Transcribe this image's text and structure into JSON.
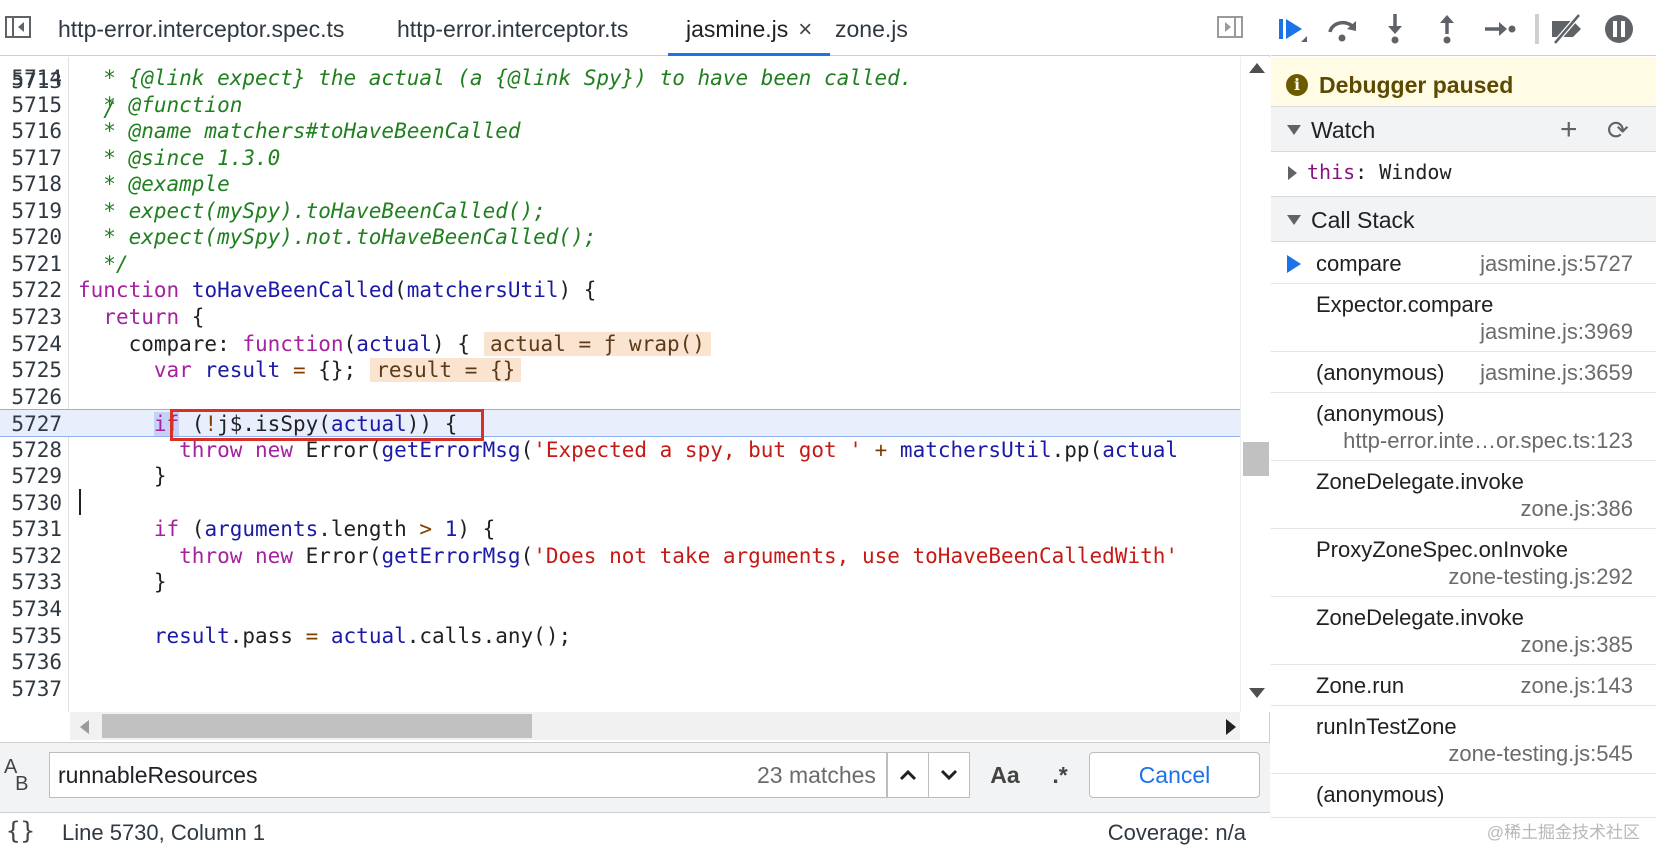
{
  "tabs": [
    {
      "label": "http-error.interceptor.spec.ts"
    },
    {
      "label": "http-error.interceptor.ts"
    },
    {
      "label": "jasmine.js",
      "close": "×"
    },
    {
      "label": "zone.js"
    }
  ],
  "code": {
    "partial_top_line": "5713",
    "lines": [
      {
        "n": "5714",
        "text": "  * {@link expect} the actual (a {@link Spy}) to have been called."
      },
      {
        "n": "5715",
        "text": "  * @function"
      },
      {
        "n": "5716",
        "text": "  * @name matchers#toHaveBeenCalled"
      },
      {
        "n": "5717",
        "text": "  * @since 1.3.0"
      },
      {
        "n": "5718",
        "text": "  * @example"
      },
      {
        "n": "5719",
        "text": "  * expect(mySpy).toHaveBeenCalled();"
      },
      {
        "n": "5720",
        "text": "  * expect(mySpy).not.toHaveBeenCalled();"
      },
      {
        "n": "5721",
        "text": "  */"
      },
      {
        "n": "5722",
        "tokens": [
          [
            "kw",
            "function"
          ],
          [
            "pl",
            " "
          ],
          [
            "fn",
            "toHaveBeenCalled"
          ],
          [
            "pl",
            "("
          ],
          [
            "va",
            "matchersUtil"
          ],
          [
            "pl",
            ") {"
          ]
        ]
      },
      {
        "n": "5723",
        "tokens": [
          [
            "pl",
            "  "
          ],
          [
            "kw",
            "return"
          ],
          [
            "pl",
            " {"
          ]
        ]
      },
      {
        "n": "5724",
        "tokens": [
          [
            "pl",
            "    compare: "
          ],
          [
            "kw",
            "function"
          ],
          [
            "pl",
            "("
          ],
          [
            "va",
            "actual"
          ],
          [
            "pl",
            ") {"
          ]
        ]
      },
      {
        "n": "5725",
        "tokens": [
          [
            "pl",
            "      "
          ],
          [
            "kw",
            "var"
          ],
          [
            "pl",
            " "
          ],
          [
            "va",
            "result"
          ],
          [
            "pl",
            " "
          ],
          [
            "op",
            "="
          ],
          [
            "pl",
            " {};"
          ]
        ]
      },
      {
        "n": "5726",
        "tokens": []
      },
      {
        "n": "5727",
        "tokens": [
          [
            "pl",
            "      "
          ],
          [
            "kwsel",
            "if"
          ],
          [
            "pl",
            " ("
          ],
          [
            "op",
            "!"
          ],
          [
            "pl",
            "j$.isSpy("
          ],
          [
            "va",
            "actual"
          ],
          [
            "pl",
            ")) {"
          ]
        ]
      },
      {
        "n": "5728",
        "tokens": [
          [
            "pl",
            "        "
          ],
          [
            "kw",
            "throw"
          ],
          [
            "pl",
            " "
          ],
          [
            "kw",
            "new"
          ],
          [
            "pl",
            " Error("
          ],
          [
            "fn",
            "getErrorMsg"
          ],
          [
            "pl",
            "("
          ],
          [
            "st",
            "'Expected a spy, but got '"
          ],
          [
            "pl",
            " "
          ],
          [
            "op",
            "+"
          ],
          [
            "pl",
            " "
          ],
          [
            "va",
            "matchersUtil"
          ],
          [
            "pl",
            ".pp("
          ],
          [
            "va",
            "actual"
          ]
        ]
      },
      {
        "n": "5729",
        "tokens": [
          [
            "pl",
            "      }"
          ]
        ]
      },
      {
        "n": "5730",
        "tokens": []
      },
      {
        "n": "5731",
        "tokens": [
          [
            "pl",
            "      "
          ],
          [
            "kw",
            "if"
          ],
          [
            "pl",
            " ("
          ],
          [
            "va",
            "arguments"
          ],
          [
            "pl",
            ".length "
          ],
          [
            "op",
            ">"
          ],
          [
            "pl",
            " "
          ],
          [
            "va",
            "1"
          ],
          [
            "pl",
            ") {"
          ]
        ]
      },
      {
        "n": "5732",
        "tokens": [
          [
            "pl",
            "        "
          ],
          [
            "kw",
            "throw"
          ],
          [
            "pl",
            " "
          ],
          [
            "kw",
            "new"
          ],
          [
            "pl",
            " Error("
          ],
          [
            "fn",
            "getErrorMsg"
          ],
          [
            "pl",
            "("
          ],
          [
            "st",
            "'Does not take arguments, use toHaveBeenCalledWith'"
          ]
        ]
      },
      {
        "n": "5733",
        "tokens": [
          [
            "pl",
            "      }"
          ]
        ]
      },
      {
        "n": "5734",
        "tokens": []
      },
      {
        "n": "5735",
        "tokens": [
          [
            "pl",
            "      "
          ],
          [
            "va",
            "result"
          ],
          [
            "pl",
            ".pass "
          ],
          [
            "op",
            "="
          ],
          [
            "pl",
            " "
          ],
          [
            "va",
            "actual"
          ],
          [
            "pl",
            ".calls.any();"
          ]
        ]
      },
      {
        "n": "5736",
        "tokens": []
      },
      {
        "n": "5737",
        "tokens": []
      }
    ],
    "inline_values": {
      "5724": "actual = ƒ wrap()",
      "5725": "result = {}"
    },
    "current_line": "5727",
    "caret_line": "5730"
  },
  "search": {
    "query": "runnableResources",
    "matches": "23 matches",
    "match_case_label": "Aa",
    "regex_label": ".*",
    "cancel_label": "Cancel"
  },
  "status": {
    "pretty_print": "{}",
    "cursor": "Line 5730, Column 1",
    "coverage": "Coverage: n/a"
  },
  "debugger": {
    "paused_text": "Debugger paused",
    "watch_title": "Watch",
    "watch_add": "+",
    "watch_refresh": "⟳",
    "watch_name": "this",
    "watch_sep": ": ",
    "watch_value": "Window",
    "callstack_title": "Call Stack",
    "frames": [
      {
        "name": "compare",
        "loc": "jasmine.js:5727",
        "current": true
      },
      {
        "name": "Expector.compare",
        "loc": "jasmine.js:3969"
      },
      {
        "name": "(anonymous)",
        "loc": "jasmine.js:3659"
      },
      {
        "name": "(anonymous)",
        "loc": "http-error.inte…or.spec.ts:123"
      },
      {
        "name": "ZoneDelegate.invoke",
        "loc": "zone.js:386"
      },
      {
        "name": "ProxyZoneSpec.onInvoke",
        "loc": "zone-testing.js:292"
      },
      {
        "name": "ZoneDelegate.invoke",
        "loc": "zone.js:385"
      },
      {
        "name": "Zone.run",
        "loc": "zone.js:143"
      },
      {
        "name": "runInTestZone",
        "loc": "zone-testing.js:545"
      },
      {
        "name": "(anonymous)",
        "loc": ""
      }
    ]
  },
  "watermark": "@稀土掘金技术社区",
  "colors": {
    "accent": "#1a73e8",
    "highlight_box": "#d93025",
    "paused_bg": "#fffbe5"
  }
}
